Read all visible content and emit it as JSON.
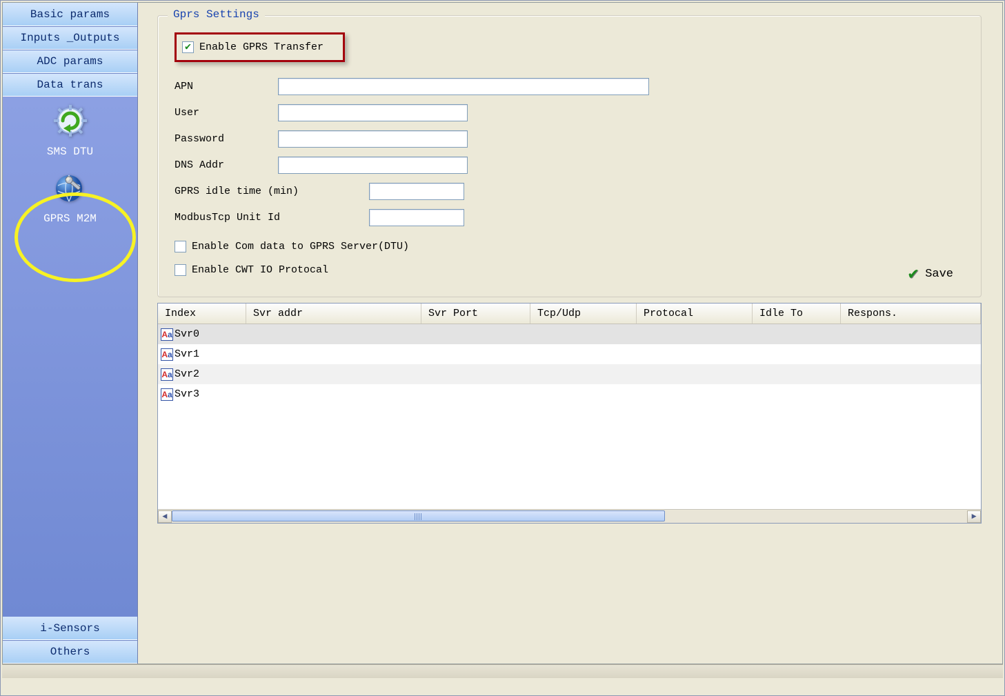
{
  "sidebar": {
    "top": [
      {
        "label": "Basic params"
      },
      {
        "label": "Inputs _Outputs"
      },
      {
        "label": "ADC params"
      },
      {
        "label": "Data trans"
      }
    ],
    "middle": [
      {
        "id": "sms-dtu",
        "label": "SMS DTU"
      },
      {
        "id": "gprs-m2m",
        "label": "GPRS M2M"
      }
    ],
    "bottom": [
      {
        "label": "i-Sensors"
      },
      {
        "label": "Others"
      }
    ]
  },
  "group": {
    "title": "Gprs Settings",
    "enable_gprs": {
      "label": "Enable GPRS Transfer",
      "checked": true
    },
    "apn": {
      "label": "APN",
      "value": ""
    },
    "user": {
      "label": "User",
      "value": ""
    },
    "password": {
      "label": "Password",
      "value": ""
    },
    "dns": {
      "label": "DNS Addr",
      "value": ""
    },
    "idle": {
      "label": "GPRS idle time (min)",
      "value": ""
    },
    "modbus": {
      "label": "ModbusTcp Unit Id",
      "value": ""
    },
    "cb_dtu": {
      "label": "Enable Com data to GPRS Server(DTU)",
      "checked": false
    },
    "cb_cwt": {
      "label": "Enable CWT IO Protocal",
      "checked": false
    },
    "save_label": "Save"
  },
  "table": {
    "headers": [
      "Index",
      "Svr addr",
      "Svr Port",
      "Tcp/Udp",
      "Protocal",
      "Idle To",
      "Respons."
    ],
    "rows": [
      {
        "index": "Svr0"
      },
      {
        "index": "Svr1"
      },
      {
        "index": "Svr2"
      },
      {
        "index": "Svr3"
      }
    ]
  }
}
